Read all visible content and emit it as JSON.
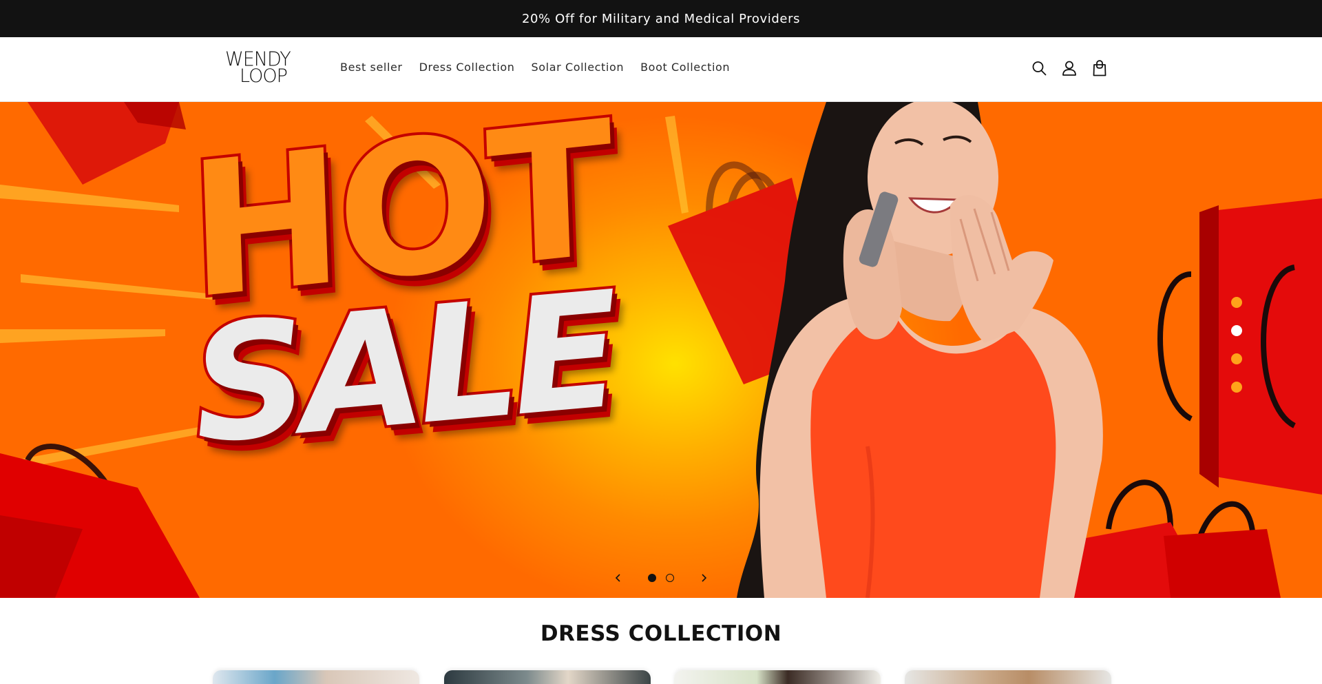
{
  "announcement": {
    "text": "20% Off for Military and Medical Providers"
  },
  "header": {
    "logo": {
      "line1": "WENDY",
      "line2": "LOOP"
    },
    "nav": [
      {
        "label": "Best seller"
      },
      {
        "label": "Dress Collection"
      },
      {
        "label": "Solar Collection"
      },
      {
        "label": "Boot Collection"
      }
    ],
    "icons": [
      "search-icon",
      "account-icon",
      "cart-icon"
    ]
  },
  "hero": {
    "banner_words": [
      "HOT",
      "SALE"
    ],
    "slide_count": 2,
    "active_slide": 1,
    "decorative_dots": 4,
    "colors": {
      "bg_center": "#ffe100",
      "bg_edge": "#ff6a00",
      "accent_red": "#d90000",
      "dress": "#ff4a1c"
    }
  },
  "section": {
    "title": "DRESS COLLECTION"
  },
  "colors": {
    "announcement_bg": "#121212",
    "text": "#121212"
  }
}
